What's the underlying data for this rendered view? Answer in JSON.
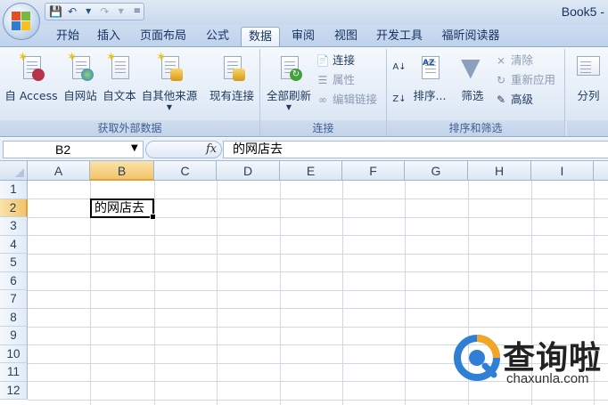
{
  "window": {
    "title": "Book5 -"
  },
  "quick_access": {
    "icons": [
      "save-icon",
      "undo-icon",
      "redo-icon",
      "customize-icon"
    ]
  },
  "tabs": [
    {
      "label": "开始"
    },
    {
      "label": "插入"
    },
    {
      "label": "页面布局"
    },
    {
      "label": "公式"
    },
    {
      "label": "数据",
      "active": true
    },
    {
      "label": "审阅"
    },
    {
      "label": "视图"
    },
    {
      "label": "开发工具"
    },
    {
      "label": "福昕阅读器"
    }
  ],
  "ribbon": {
    "external": {
      "label": "获取外部数据",
      "buttons": [
        "自 Access",
        "自网站",
        "自文本",
        "自其他来源",
        "现有连接"
      ]
    },
    "connections": {
      "label": "连接",
      "refresh_all": "全部刷新",
      "items": [
        "连接",
        "属性",
        "编辑链接"
      ]
    },
    "sort_filter": {
      "label": "排序和筛选",
      "sort": "排序...",
      "filter": "筛选",
      "items": [
        "清除",
        "重新应用",
        "高级"
      ]
    },
    "tools": {
      "split": "分列"
    }
  },
  "formula_bar": {
    "name_box": "B2",
    "fx": "fx",
    "value": "的网店去"
  },
  "grid": {
    "columns": [
      "A",
      "B",
      "C",
      "D",
      "E",
      "F",
      "G",
      "H",
      "I"
    ],
    "rows": [
      "1",
      "2",
      "3",
      "4",
      "5",
      "6",
      "7",
      "8",
      "9",
      "10",
      "11",
      "12"
    ],
    "selected_cell": {
      "ref": "B2",
      "value": "的网店去"
    }
  },
  "watermark": {
    "text": "查询啦",
    "url": "chaxunla.com"
  },
  "colors": {
    "accent": "#f3c46b",
    "ribbon": "#dfe9f5",
    "text": "#1e395b"
  }
}
